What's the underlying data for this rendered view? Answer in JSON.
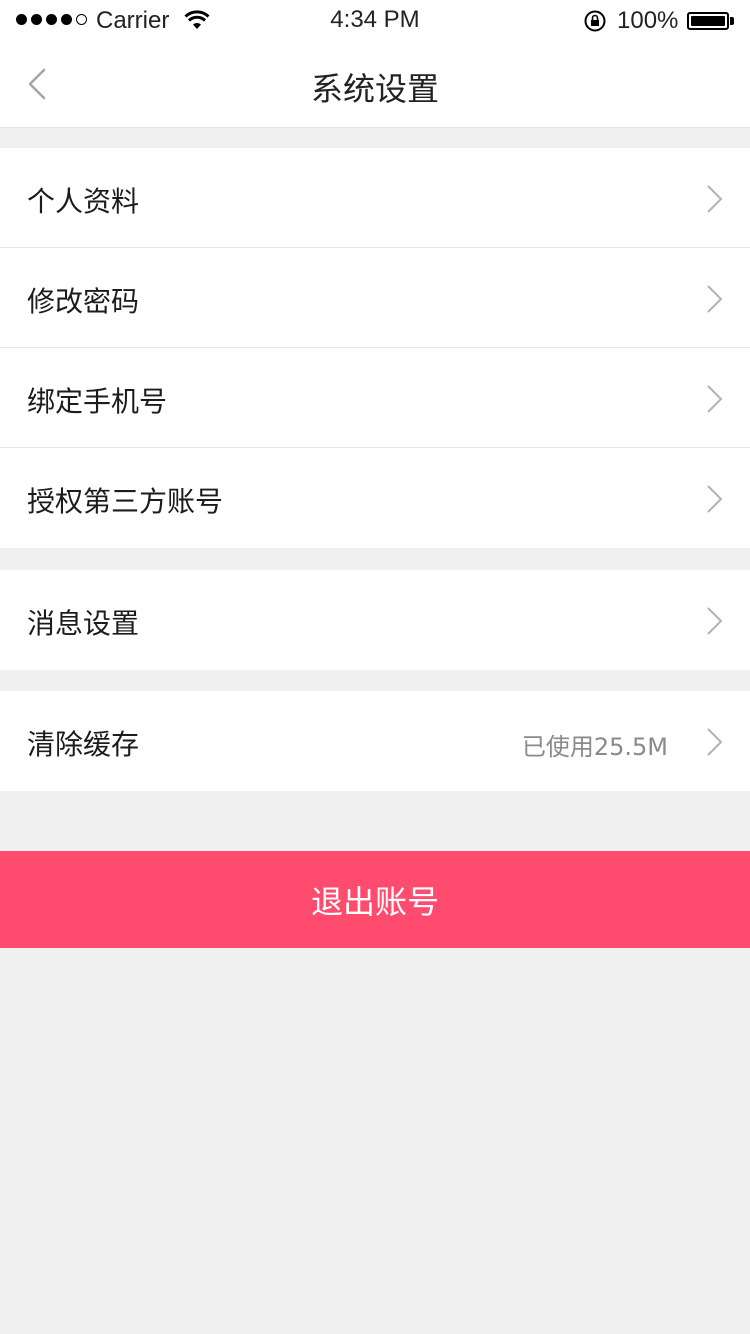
{
  "status_bar": {
    "carrier": "Carrier",
    "time": "4:34 PM",
    "battery": "100%",
    "signal_filled": 4,
    "signal_total": 5
  },
  "nav": {
    "title": "系统设置",
    "back_icon": "chevron-left-icon"
  },
  "groups": [
    {
      "items": [
        {
          "label": "个人资料"
        },
        {
          "label": "修改密码"
        },
        {
          "label": "绑定手机号"
        },
        {
          "label": "授权第三方账号"
        }
      ]
    },
    {
      "items": [
        {
          "label": "消息设置"
        }
      ]
    },
    {
      "items": [
        {
          "label": "清除缓存",
          "value": "已使用25.5M"
        }
      ]
    }
  ],
  "logout_label": "退出账号",
  "colors": {
    "accent": "#ff4b6e",
    "background": "#f0f0f0",
    "chevron": "#b3b3b3"
  }
}
